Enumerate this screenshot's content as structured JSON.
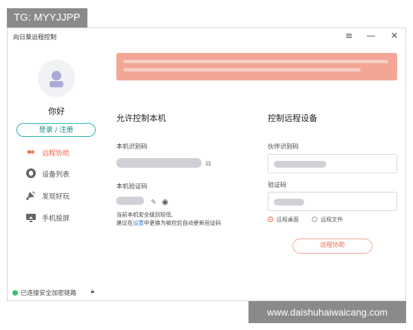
{
  "overlay_tag": "TG: MYYJJPP",
  "watermark": "www.daishuhaiwaicang.com",
  "window": {
    "title": "向日葵远程控制",
    "menu_icon": "menu-icon",
    "minimize_icon": "minimize-icon",
    "close_icon": "close-icon"
  },
  "sidebar": {
    "greeting": "你好",
    "login_label": "登录 / 注册",
    "items": [
      {
        "label": "远程协助",
        "icon": "remote-assist-icon",
        "active": true
      },
      {
        "label": "设备列表",
        "icon": "device-list-icon",
        "active": false
      },
      {
        "label": "发现好玩",
        "icon": "discover-icon",
        "active": false
      },
      {
        "label": "手机投屏",
        "icon": "screen-cast-icon",
        "active": false
      }
    ],
    "status_text": "已连接安全加密链路"
  },
  "allow_panel": {
    "title": "允许控制本机",
    "id_label": "本机识别码",
    "code_label": "本机验证码",
    "note_line1": "当前本机安全级别较低.",
    "note_line2_prefix": "建议在",
    "note_link": "设置",
    "note_line2_suffix": "中更换为被控后自动更新验证码"
  },
  "control_panel": {
    "title": "控制远程设备",
    "partner_label": "伙伴识别码",
    "code_label": "验证码",
    "radio_desktop": "远程桌面",
    "radio_files": "远程文件",
    "assist_button": "远程协助"
  },
  "colors": {
    "accent": "#ec6a4e",
    "teal": "#19b3a6",
    "notice_bg": "#f3a695",
    "status_green": "#35c26a"
  }
}
